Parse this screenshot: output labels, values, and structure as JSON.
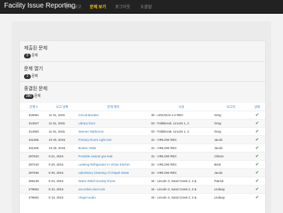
{
  "nav": {
    "brand": "Facility Issue Reporting",
    "items": [
      {
        "label": "문제 보고",
        "active": false
      },
      {
        "label": "문제 보기",
        "active": true
      },
      {
        "label": "로그아웃",
        "active": false
      },
      {
        "label": "도움말",
        "active": false
      }
    ]
  },
  "sections": [
    {
      "title": "제출된 문제",
      "count": "0",
      "count_label": "문제"
    },
    {
      "title": "문제 열기",
      "count": "2",
      "count_label": "문제"
    },
    {
      "title": "종결된 문제",
      "count": "380",
      "count_label": "문제"
    }
  ],
  "table": {
    "headers": [
      "문제 #",
      "보고 날짜",
      "문제 제목",
      "시설",
      "보고자",
      "상태"
    ],
    "rows": [
      {
        "id": "315061",
        "date": "11 01, 2015",
        "title": "Circuit Breaker",
        "facility": "30 - LINCOLN 1-2 REC",
        "reporter": "Greg"
      },
      {
        "id": "314947",
        "date": "11 01, 2015",
        "title": "Library Door",
        "facility": "03 - Fallsbrook, Lincoln 1, 2",
        "reporter": "Greg"
      },
      {
        "id": "314900",
        "date": "11 01, 2015",
        "title": "Women' Bathroom",
        "facility": "03 - Fallsbrook, Lincoln 1, 2",
        "reporter": "Greg"
      },
      {
        "id": "311265",
        "date": "10 20, 2015",
        "title": "Primary Room Light Out",
        "facility": "31 - VIRLOW REC",
        "reporter": "Jacob"
      },
      {
        "id": "311265",
        "date": "10 20, 2015",
        "title": "Broken Toilet",
        "facility": "31 - VIRLOW REC",
        "reporter": "Jacob"
      },
      {
        "id": "297523",
        "date": "9 21, 2015",
        "title": "Possible natural gas leak",
        "facility": "31 - VIRLOW REC",
        "reporter": "Clinton"
      },
      {
        "id": "297243",
        "date": "9 20, 2015",
        "title": "Leaking Refrigerator in Virlow Kitchen",
        "facility": "31 - VIRLOW REC",
        "reporter": "Brett"
      },
      {
        "id": "297536",
        "date": "8 30, 2015",
        "title": "Upholstery Cleaning of Chapel Seats",
        "facility": "31 - VIRLOW REC",
        "reporter": "Jacob"
      },
      {
        "id": "295139",
        "date": "8 23, 2015",
        "title": "Warm Relief Society Room",
        "facility": "34 - Lincoln 3, Sand Creek 2, 3 &",
        "reporter": "Patrick"
      },
      {
        "id": "279663",
        "date": "8 10, 2015",
        "title": "accordion door lock",
        "facility": "34 - Lincoln 3, Sand Creek 2, 3 &",
        "reporter": "Lindsay"
      },
      {
        "id": "279662",
        "date": "8 13, 2015",
        "title": "chapel audio",
        "facility": "34 - Lincoln 3, Sand Creek 2, 3 &",
        "reporter": "Lindsay"
      }
    ]
  },
  "colors": {
    "accent": "#ffcc00",
    "link": "#337ab7",
    "status_ok": "#3c763d"
  },
  "icons": {
    "status": "check-icon"
  }
}
